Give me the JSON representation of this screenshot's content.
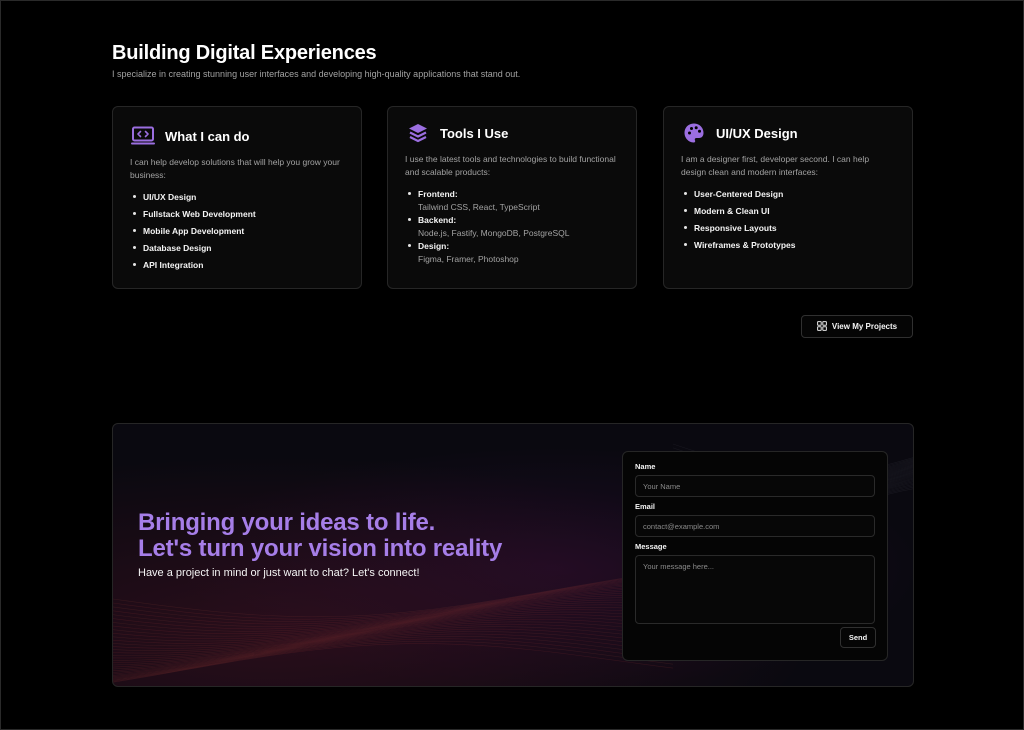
{
  "hero": {
    "title": "Building Digital Experiences",
    "subtitle": "I specialize in creating stunning user interfaces and developing high-quality applications that stand out."
  },
  "cards": {
    "skills": {
      "title": "What I can do",
      "icon": "code-monitor-icon",
      "text": "I can help develop solutions that will help you grow your business:",
      "items": [
        "UI/UX Design",
        "Fullstack Web Development",
        "Mobile App Development",
        "Database Design",
        "API Integration"
      ]
    },
    "tools": {
      "title": "Tools I Use",
      "icon": "layers-icon",
      "text": "I use the latest tools and technologies to build functional and scalable products:",
      "items": [
        {
          "label": "Frontend:",
          "value": "Tailwind CSS, React, TypeScript"
        },
        {
          "label": "Backend:",
          "value": "Node.js, Fastify, MongoDB, PostgreSQL"
        },
        {
          "label": "Design:",
          "value": "Figma, Framer, Photoshop"
        }
      ]
    },
    "design": {
      "title": "UI/UX Design",
      "icon": "palette-icon",
      "text": "I am a designer first, developer second. I can help design clean and modern interfaces:",
      "items": [
        "User-Centered Design",
        "Modern & Clean UI",
        "Responsive Layouts",
        "Wireframes & Prototypes"
      ]
    }
  },
  "projects_button": {
    "label": "View My Projects",
    "icon": "grid-icon"
  },
  "contact": {
    "heading_line1": "Bringing your ideas to life.",
    "heading_line2": "Let's turn your vision into reality",
    "subtitle": "Have a project in mind or just want to chat? Let's connect!",
    "form": {
      "name_label": "Name",
      "name_placeholder": "Your Name",
      "email_label": "Email",
      "email_placeholder": "contact@example.com",
      "message_label": "Message",
      "message_placeholder": "Your message here...",
      "send_label": "Send"
    }
  },
  "colors": {
    "accent": "#a67ee8",
    "icon_purple": "#9b6ee0",
    "background": "#000000"
  }
}
